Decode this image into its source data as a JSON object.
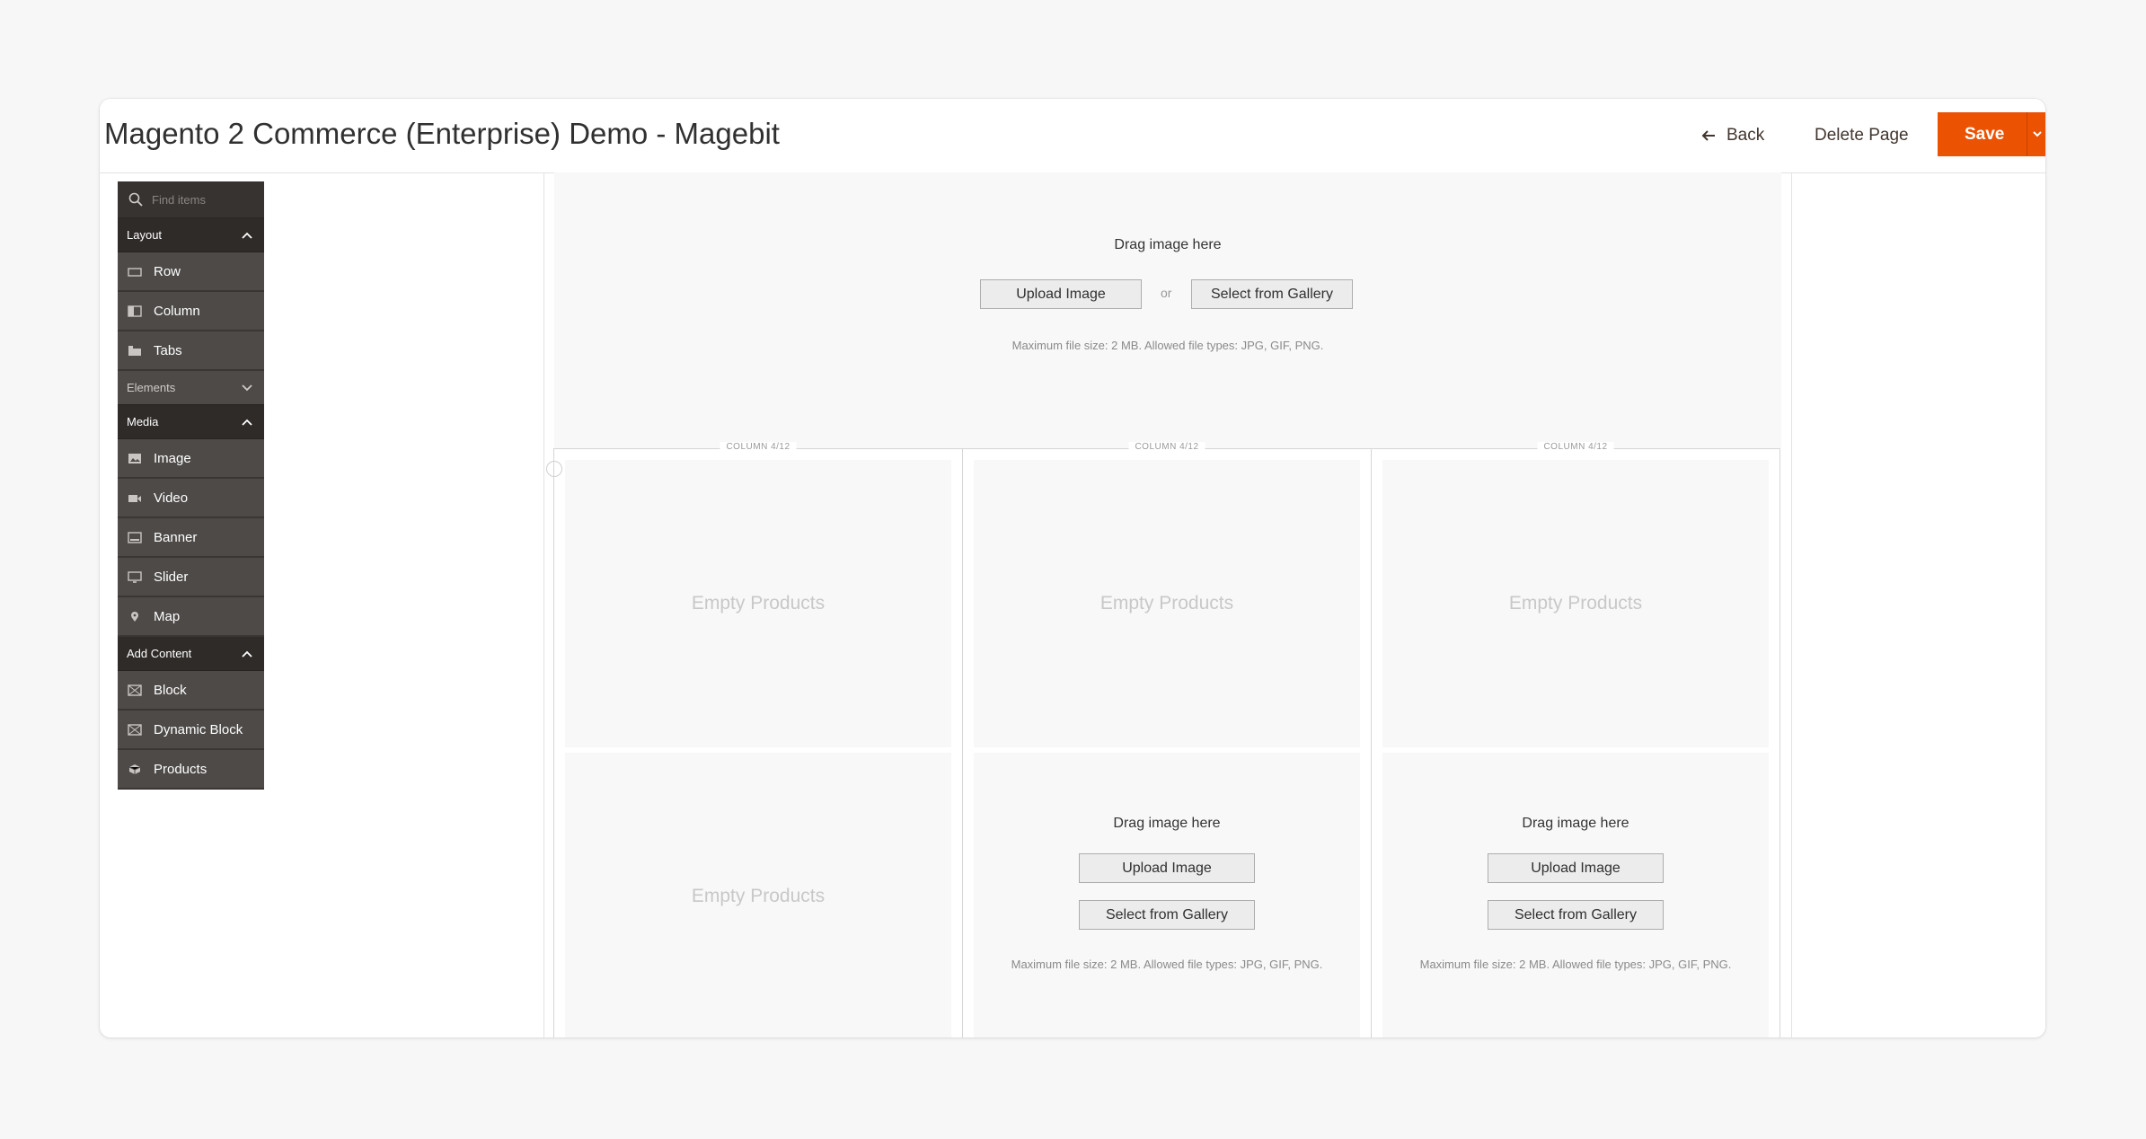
{
  "header": {
    "title": "Magento 2 Commerce (Enterprise) Demo - Magebit",
    "back_label": "Back",
    "delete_label": "Delete Page",
    "save_label": "Save"
  },
  "colors": {
    "accent": "#eb5202",
    "panel_bg": "#4d4a48",
    "panel_header": "#2f2b29"
  },
  "panel": {
    "search_placeholder": "Find items",
    "sections": [
      {
        "title": "Layout",
        "expanded": true,
        "items": [
          {
            "label": "Row",
            "icon": "row-icon"
          },
          {
            "label": "Column",
            "icon": "column-icon"
          },
          {
            "label": "Tabs",
            "icon": "tabs-icon"
          }
        ]
      },
      {
        "title": "Elements",
        "expanded": false,
        "items": []
      },
      {
        "title": "Media",
        "expanded": true,
        "items": [
          {
            "label": "Image",
            "icon": "image-icon"
          },
          {
            "label": "Video",
            "icon": "video-icon"
          },
          {
            "label": "Banner",
            "icon": "banner-icon"
          },
          {
            "label": "Slider",
            "icon": "slider-icon"
          },
          {
            "label": "Map",
            "icon": "map-pin-icon"
          }
        ]
      },
      {
        "title": "Add Content",
        "expanded": true,
        "items": [
          {
            "label": "Block",
            "icon": "block-icon"
          },
          {
            "label": "Dynamic Block",
            "icon": "dynamic-block-icon"
          },
          {
            "label": "Products",
            "icon": "products-icon"
          }
        ]
      }
    ]
  },
  "stage": {
    "image_uploader": {
      "drag_text": "Drag image here",
      "upload_label": "Upload Image",
      "or_text": "or",
      "gallery_label": "Select from Gallery",
      "hint": "Maximum file size: 2 MB. Allowed file types: JPG, GIF, PNG."
    },
    "columns": [
      {
        "label": "COLUMN 4/12",
        "top": "Empty Products",
        "bottom": "Empty Products"
      },
      {
        "label": "COLUMN 4/12",
        "top": "Empty Products"
      },
      {
        "label": "COLUMN 4/12",
        "top": "Empty Products"
      }
    ]
  }
}
